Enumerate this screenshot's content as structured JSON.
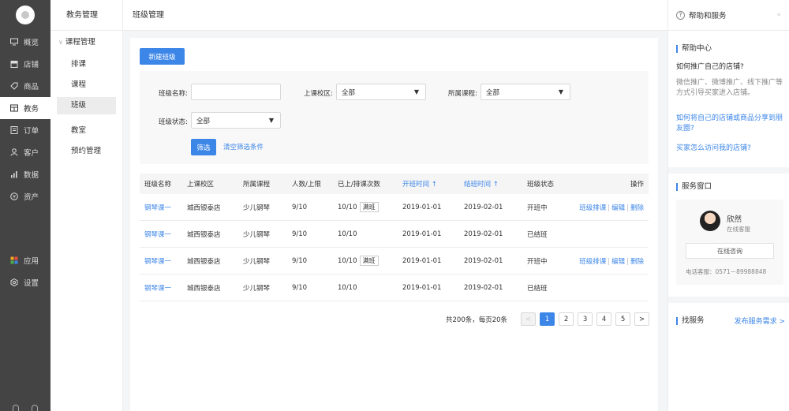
{
  "nav": {
    "items": [
      {
        "label": "概览",
        "icon": "monitor-icon"
      },
      {
        "label": "店铺",
        "icon": "shop-icon"
      },
      {
        "label": "商品",
        "icon": "tag-icon"
      },
      {
        "label": "教务",
        "icon": "education-icon"
      },
      {
        "label": "订单",
        "icon": "order-icon"
      },
      {
        "label": "客户",
        "icon": "user-icon"
      },
      {
        "label": "数据",
        "icon": "bar-chart-icon"
      },
      {
        "label": "资产",
        "icon": "coin-icon"
      }
    ],
    "bottom": [
      {
        "label": "应用",
        "icon": "apps-icon"
      },
      {
        "label": "设置",
        "icon": "gear-icon"
      }
    ]
  },
  "subnav": {
    "title": "教务管理",
    "group": "课程管理",
    "items": [
      "排课",
      "课程",
      "班级",
      "教室",
      "预约管理"
    ]
  },
  "header": {
    "title": "班级管理"
  },
  "actions": {
    "new_class": "新建班级"
  },
  "filters": {
    "class_name_label": "班级名称:",
    "class_name_value": "",
    "campus_label": "上课校区:",
    "campus_value": "全部",
    "course_label": "所属课程:",
    "course_value": "全部",
    "status_label": "班级状态:",
    "status_value": "全部",
    "filter_btn": "筛选",
    "clear_link": "清空筛选条件"
  },
  "table": {
    "columns": [
      "班级名称",
      "上课校区",
      "所属课程",
      "人数/上限",
      "已上/排课次数",
      "开班时间 ↑",
      "结班时间 ↑",
      "班级状态",
      "操作"
    ],
    "rows": [
      {
        "name": "钢琴课一",
        "campus": "城西银泰店",
        "course": "少儿钢琴",
        "count": "9/10",
        "sessions": "10/10",
        "tag": "满班",
        "start": "2019-01-01",
        "end": "2019-02-01",
        "status": "开班中",
        "ops": [
          "班级排课",
          "编辑",
          "删除"
        ]
      },
      {
        "name": "钢琴课一",
        "campus": "城西银泰店",
        "course": "少儿钢琴",
        "count": "9/10",
        "sessions": "10/10",
        "tag": "",
        "start": "2019-01-01",
        "end": "2019-02-01",
        "status": "已结班",
        "ops": []
      },
      {
        "name": "钢琴课一",
        "campus": "城西银泰店",
        "course": "少儿钢琴",
        "count": "9/10",
        "sessions": "10/10",
        "tag": "满班",
        "start": "2019-01-01",
        "end": "2019-02-01",
        "status": "开班中",
        "ops": [
          "班级排课",
          "编辑",
          "删除"
        ]
      },
      {
        "name": "钢琴课一",
        "campus": "城西银泰店",
        "course": "少儿钢琴",
        "count": "9/10",
        "sessions": "10/10",
        "tag": "",
        "start": "2019-01-01",
        "end": "2019-02-01",
        "status": "已结班",
        "ops": []
      }
    ]
  },
  "pagination": {
    "summary": "共200条，每页20条",
    "prev": "<",
    "pages": [
      "1",
      "2",
      "3",
      "4",
      "5"
    ],
    "next": ">",
    "current": "1"
  },
  "help": {
    "title": "帮助和服务",
    "center_title": "帮助中心",
    "q1": "如何推广自己的店铺?",
    "a1": "微信推广、微博推广、线下推广等方式引导买家进入店铺。",
    "link1": "如何将自己的店铺或商品分享到朋友圈?",
    "link2": "买家怎么访问我的店铺?",
    "service_title": "服务窗口",
    "agent_name": "欣然",
    "agent_status": "在线客服",
    "consult_btn": "在线咨询",
    "phone": "电话客服：0571－89988848",
    "find_title": "找服务",
    "publish_link": "发布服务需求 >"
  },
  "colors": {
    "accent": "#3c86e8",
    "nav_bg": "#444444"
  }
}
